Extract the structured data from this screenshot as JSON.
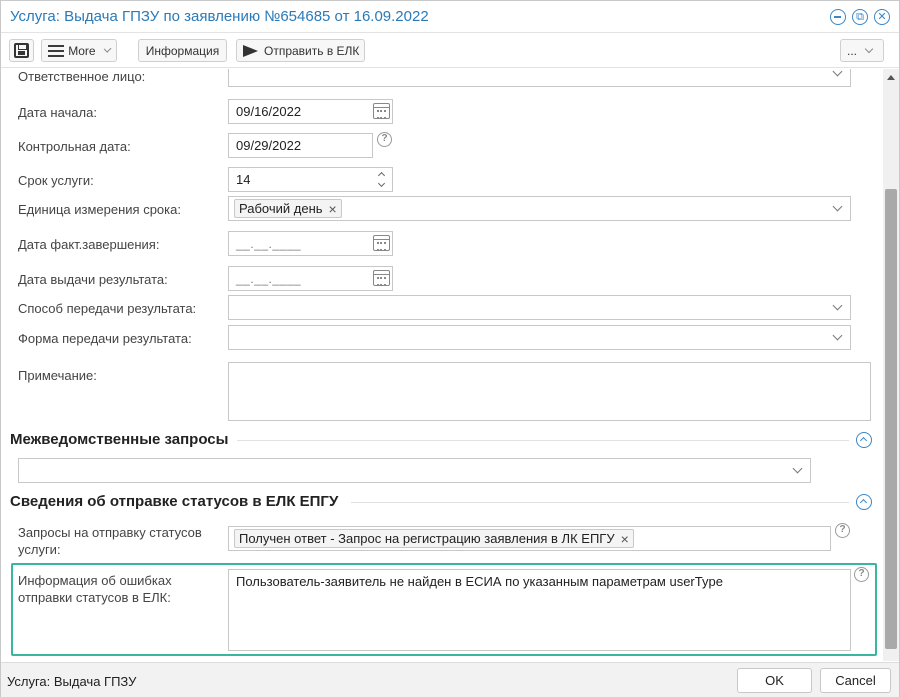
{
  "window": {
    "title": "Услуга: Выдача ГПЗУ по заявлению №654685 от 16.09.2022",
    "accent_color": "#3c86c6"
  },
  "toolbar": {
    "more_label": "More",
    "info_label": "Информация",
    "send_label": "Отправить в ЕЛК",
    "overflow_label": "..."
  },
  "form": {
    "responsible": {
      "label": "Ответственное лицо:",
      "value": ""
    },
    "start_date": {
      "label": "Дата начала:",
      "value": "09/16/2022"
    },
    "control_date": {
      "label": "Контрольная дата:",
      "value": "09/29/2022"
    },
    "service_term": {
      "label": "Срок услуги:",
      "value": "14"
    },
    "term_unit": {
      "label": "Единица измерения срока:",
      "tag": "Рабочий день"
    },
    "actual_end": {
      "label": "Дата факт.завершения:",
      "mask": "__.__.____"
    },
    "result_date": {
      "label": "Дата выдачи результата:",
      "mask": "__.__.____"
    },
    "transfer_method": {
      "label": "Способ передачи результата:",
      "value": ""
    },
    "transfer_form": {
      "label": "Форма передачи результата:",
      "value": ""
    },
    "note": {
      "label": "Примечание:",
      "value": ""
    }
  },
  "interagency": {
    "title": "Межведомственные запросы",
    "value": ""
  },
  "status_section": {
    "title": "Сведения об отправке статусов в ЕЛК ЕПГУ",
    "requests_label_1": "Запросы на отправку статусов",
    "requests_label_2": "услуги:",
    "requests_tag": "Получен ответ - Запрос на регистрацию заявления в ЛК ЕПГУ",
    "errors_label_1": "Информация об ошибках",
    "errors_label_2": "отправки статусов в ЕЛК:",
    "errors_value": "Пользователь-заявитель не найден в ЕСИА по указанным параметрам userType",
    "highlight_color": "#39b5a0"
  },
  "footer": {
    "status_text": "Услуга: Выдача ГПЗУ",
    "ok_label": "OK",
    "cancel_label": "Cancel"
  }
}
